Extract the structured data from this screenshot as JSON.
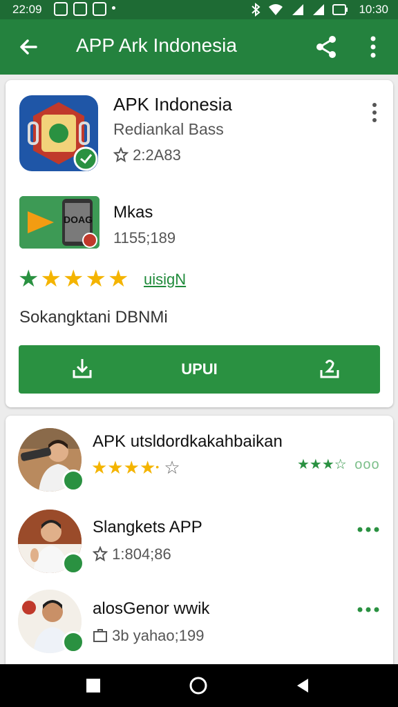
{
  "status_bar": {
    "time": "22:09",
    "clock": "10:30",
    "left_icons": [
      "notification-icon",
      "lock-icon",
      "message-icon"
    ],
    "right_icons": [
      "bluetooth-icon",
      "wifi-icon",
      "signal-icon",
      "signal-icon",
      "battery-icon"
    ]
  },
  "app_bar": {
    "title": "APP Ark Indonesia",
    "icons": [
      "back-arrow-icon",
      "share-icon",
      "more-vert-icon"
    ]
  },
  "main_app": {
    "name": "APK Indonesia",
    "developer": "Rediankal Bass",
    "meta": "2:2A83",
    "meta_icon": "badge-star-icon"
  },
  "second_app": {
    "name": "Mkas",
    "meta": "1155;189",
    "icon_text": "DOAG"
  },
  "rating": {
    "stars": 5,
    "link_text": "uisigN"
  },
  "description": "Sokangktani DBNMi",
  "install_button": {
    "label": "UPUI",
    "left_icon": "download-icon",
    "right_icon": "share-upload-icon"
  },
  "list": [
    {
      "name": "APK utsldordkakahbaikan",
      "rating_stars": 3.5,
      "right_stars": 3.5,
      "right_text": "ooo"
    },
    {
      "name": "Slangkets APP",
      "meta_icon": "star-outline-icon",
      "meta": "1:804;86"
    },
    {
      "name": "alosGenor wwik",
      "meta_icon": "briefcase-icon",
      "meta": "3b yahao;199"
    }
  ],
  "colors": {
    "primary": "#24823e",
    "status_bar": "#1e6b34",
    "accent_green": "#2a9141",
    "star_gold": "#f4b400"
  }
}
